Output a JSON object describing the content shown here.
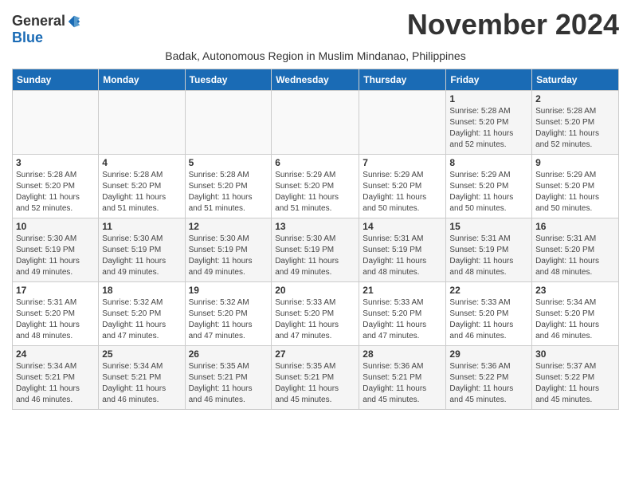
{
  "header": {
    "logo": {
      "general": "General",
      "blue": "Blue"
    },
    "month_year": "November 2024",
    "subtitle": "Badak, Autonomous Region in Muslim Mindanao, Philippines"
  },
  "weekdays": [
    "Sunday",
    "Monday",
    "Tuesday",
    "Wednesday",
    "Thursday",
    "Friday",
    "Saturday"
  ],
  "weeks": [
    [
      {
        "day": "",
        "info": ""
      },
      {
        "day": "",
        "info": ""
      },
      {
        "day": "",
        "info": ""
      },
      {
        "day": "",
        "info": ""
      },
      {
        "day": "",
        "info": ""
      },
      {
        "day": "1",
        "info": "Sunrise: 5:28 AM\nSunset: 5:20 PM\nDaylight: 11 hours\nand 52 minutes."
      },
      {
        "day": "2",
        "info": "Sunrise: 5:28 AM\nSunset: 5:20 PM\nDaylight: 11 hours\nand 52 minutes."
      }
    ],
    [
      {
        "day": "3",
        "info": "Sunrise: 5:28 AM\nSunset: 5:20 PM\nDaylight: 11 hours\nand 52 minutes."
      },
      {
        "day": "4",
        "info": "Sunrise: 5:28 AM\nSunset: 5:20 PM\nDaylight: 11 hours\nand 51 minutes."
      },
      {
        "day": "5",
        "info": "Sunrise: 5:28 AM\nSunset: 5:20 PM\nDaylight: 11 hours\nand 51 minutes."
      },
      {
        "day": "6",
        "info": "Sunrise: 5:29 AM\nSunset: 5:20 PM\nDaylight: 11 hours\nand 51 minutes."
      },
      {
        "day": "7",
        "info": "Sunrise: 5:29 AM\nSunset: 5:20 PM\nDaylight: 11 hours\nand 50 minutes."
      },
      {
        "day": "8",
        "info": "Sunrise: 5:29 AM\nSunset: 5:20 PM\nDaylight: 11 hours\nand 50 minutes."
      },
      {
        "day": "9",
        "info": "Sunrise: 5:29 AM\nSunset: 5:20 PM\nDaylight: 11 hours\nand 50 minutes."
      }
    ],
    [
      {
        "day": "10",
        "info": "Sunrise: 5:30 AM\nSunset: 5:19 PM\nDaylight: 11 hours\nand 49 minutes."
      },
      {
        "day": "11",
        "info": "Sunrise: 5:30 AM\nSunset: 5:19 PM\nDaylight: 11 hours\nand 49 minutes."
      },
      {
        "day": "12",
        "info": "Sunrise: 5:30 AM\nSunset: 5:19 PM\nDaylight: 11 hours\nand 49 minutes."
      },
      {
        "day": "13",
        "info": "Sunrise: 5:30 AM\nSunset: 5:19 PM\nDaylight: 11 hours\nand 49 minutes."
      },
      {
        "day": "14",
        "info": "Sunrise: 5:31 AM\nSunset: 5:19 PM\nDaylight: 11 hours\nand 48 minutes."
      },
      {
        "day": "15",
        "info": "Sunrise: 5:31 AM\nSunset: 5:19 PM\nDaylight: 11 hours\nand 48 minutes."
      },
      {
        "day": "16",
        "info": "Sunrise: 5:31 AM\nSunset: 5:20 PM\nDaylight: 11 hours\nand 48 minutes."
      }
    ],
    [
      {
        "day": "17",
        "info": "Sunrise: 5:31 AM\nSunset: 5:20 PM\nDaylight: 11 hours\nand 48 minutes."
      },
      {
        "day": "18",
        "info": "Sunrise: 5:32 AM\nSunset: 5:20 PM\nDaylight: 11 hours\nand 47 minutes."
      },
      {
        "day": "19",
        "info": "Sunrise: 5:32 AM\nSunset: 5:20 PM\nDaylight: 11 hours\nand 47 minutes."
      },
      {
        "day": "20",
        "info": "Sunrise: 5:33 AM\nSunset: 5:20 PM\nDaylight: 11 hours\nand 47 minutes."
      },
      {
        "day": "21",
        "info": "Sunrise: 5:33 AM\nSunset: 5:20 PM\nDaylight: 11 hours\nand 47 minutes."
      },
      {
        "day": "22",
        "info": "Sunrise: 5:33 AM\nSunset: 5:20 PM\nDaylight: 11 hours\nand 46 minutes."
      },
      {
        "day": "23",
        "info": "Sunrise: 5:34 AM\nSunset: 5:20 PM\nDaylight: 11 hours\nand 46 minutes."
      }
    ],
    [
      {
        "day": "24",
        "info": "Sunrise: 5:34 AM\nSunset: 5:21 PM\nDaylight: 11 hours\nand 46 minutes."
      },
      {
        "day": "25",
        "info": "Sunrise: 5:34 AM\nSunset: 5:21 PM\nDaylight: 11 hours\nand 46 minutes."
      },
      {
        "day": "26",
        "info": "Sunrise: 5:35 AM\nSunset: 5:21 PM\nDaylight: 11 hours\nand 46 minutes."
      },
      {
        "day": "27",
        "info": "Sunrise: 5:35 AM\nSunset: 5:21 PM\nDaylight: 11 hours\nand 45 minutes."
      },
      {
        "day": "28",
        "info": "Sunrise: 5:36 AM\nSunset: 5:21 PM\nDaylight: 11 hours\nand 45 minutes."
      },
      {
        "day": "29",
        "info": "Sunrise: 5:36 AM\nSunset: 5:22 PM\nDaylight: 11 hours\nand 45 minutes."
      },
      {
        "day": "30",
        "info": "Sunrise: 5:37 AM\nSunset: 5:22 PM\nDaylight: 11 hours\nand 45 minutes."
      }
    ]
  ]
}
